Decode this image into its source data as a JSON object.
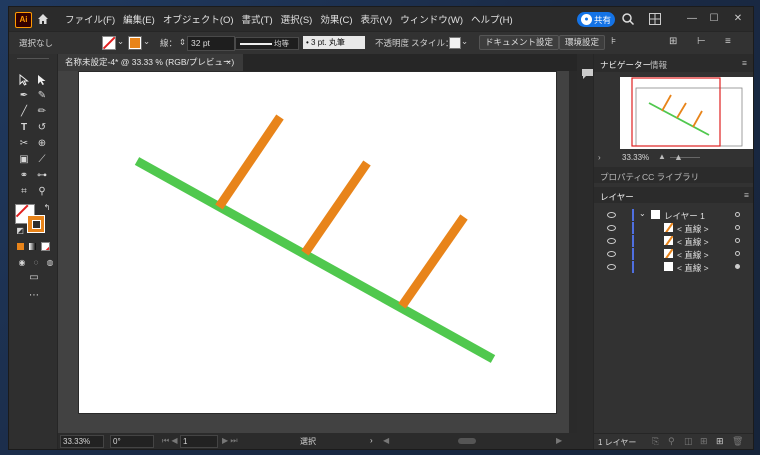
{
  "app": {
    "logo": "Ai",
    "accent": "#ff9a00"
  },
  "menu": [
    "ファイル(F)",
    "編集(E)",
    "オブジェクト(O)",
    "書式(T)",
    "選択(S)",
    "効果(C)",
    "表示(V)",
    "ウィンドウ(W)",
    "ヘルプ(H)"
  ],
  "share_label": "共有",
  "control": {
    "selection": "選択なし",
    "stroke_label": "線：",
    "stroke_value": "32 pt",
    "profile": "均等",
    "brush": "3 pt. 丸筆",
    "opacity_label": "不透明度",
    "style_label": "スタイル：",
    "doc_setup": "ドキュメント設定",
    "prefs": "環境設定"
  },
  "document_tab": {
    "title": "名称未設定-4* @ 33.33 % (RGB/プレビュー)",
    "close": "×"
  },
  "status": {
    "zoom": "33.33%",
    "rotation": "0°",
    "artboard": "1",
    "tool": "選択"
  },
  "navigator": {
    "tab1": "ナビゲーター",
    "tab2": "情報",
    "zoom": "33.33%"
  },
  "properties": {
    "tab1": "プロパティ",
    "tab2": "CC ライブラリ"
  },
  "layers": {
    "tab": "レイヤー",
    "rows": [
      {
        "name": "レイヤー 1",
        "type": "layer"
      },
      {
        "name": "< 直線 >",
        "type": "path"
      },
      {
        "name": "< 直線 >",
        "type": "path"
      },
      {
        "name": "< 直線 >",
        "type": "path"
      },
      {
        "name": "< 直線 >",
        "type": "path"
      }
    ],
    "footer": "1 レイヤー"
  },
  "colors": {
    "green_line": "#50c84e",
    "orange_line": "#e8841a",
    "layer_color": "#4f6fe0"
  }
}
